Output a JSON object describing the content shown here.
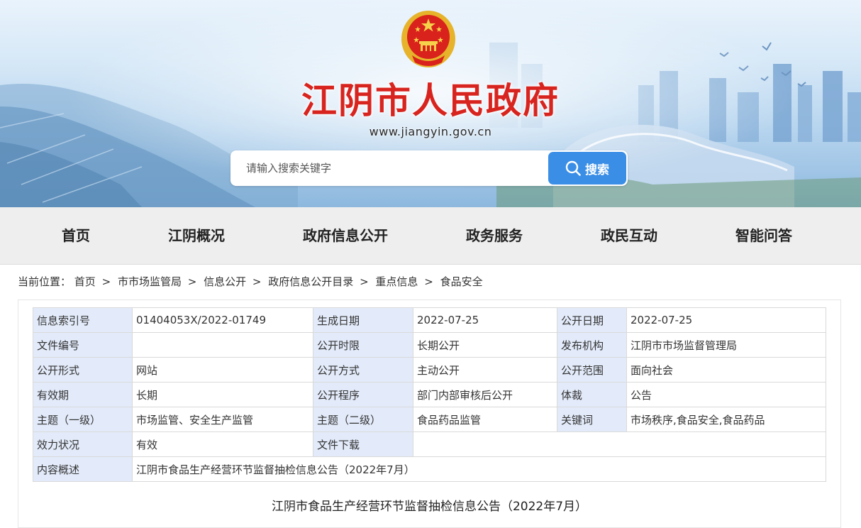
{
  "site": {
    "title": "江阴市人民政府",
    "url": "www.jiangyin.gov.cn"
  },
  "search": {
    "placeholder": "请输入搜索关键字",
    "button_label": "搜索",
    "icon": "search-icon"
  },
  "nav": {
    "items": [
      "首页",
      "江阴概况",
      "政府信息公开",
      "政务服务",
      "政民互动",
      "智能问答"
    ]
  },
  "breadcrumb": {
    "prefix": "当前位置：",
    "items": [
      "首页",
      "市市场监管局",
      "信息公开",
      "政府信息公开目录",
      "重点信息",
      "食品安全"
    ],
    "separator": ">"
  },
  "meta_table": {
    "rows": [
      [
        [
          "信息索引号",
          "01404053X/2022-01749"
        ],
        [
          "生成日期",
          "2022-07-25"
        ],
        [
          "公开日期",
          "2022-07-25"
        ]
      ],
      [
        [
          "文件编号",
          ""
        ],
        [
          "公开时限",
          "长期公开"
        ],
        [
          "发布机构",
          "江阴市市场监督管理局"
        ]
      ],
      [
        [
          "公开形式",
          "网站"
        ],
        [
          "公开方式",
          "主动公开"
        ],
        [
          "公开范围",
          "面向社会"
        ]
      ],
      [
        [
          "有效期",
          "长期"
        ],
        [
          "公开程序",
          "部门内部审核后公开"
        ],
        [
          "体裁",
          "公告"
        ]
      ],
      [
        [
          "主题（一级）",
          "市场监管、安全生产监管"
        ],
        [
          "主题（二级）",
          "食品药品监管"
        ],
        [
          "关键词",
          "市场秩序,食品安全,食品药品"
        ]
      ],
      [
        [
          "效力状况",
          "有效"
        ],
        [
          "文件下载",
          ""
        ]
      ],
      [
        [
          "内容概述",
          "江阴市食品生产经营环节监督抽检信息公告（2022年7月）"
        ]
      ]
    ]
  },
  "article": {
    "title": "江阴市食品生产经营环节监督抽检信息公告（2022年7月）"
  },
  "colors": {
    "title_red": "#d8241f",
    "search_blue": "#3a8ee6",
    "label_bg": "#e3ebfa",
    "nav_bg": "#eeeeee"
  }
}
